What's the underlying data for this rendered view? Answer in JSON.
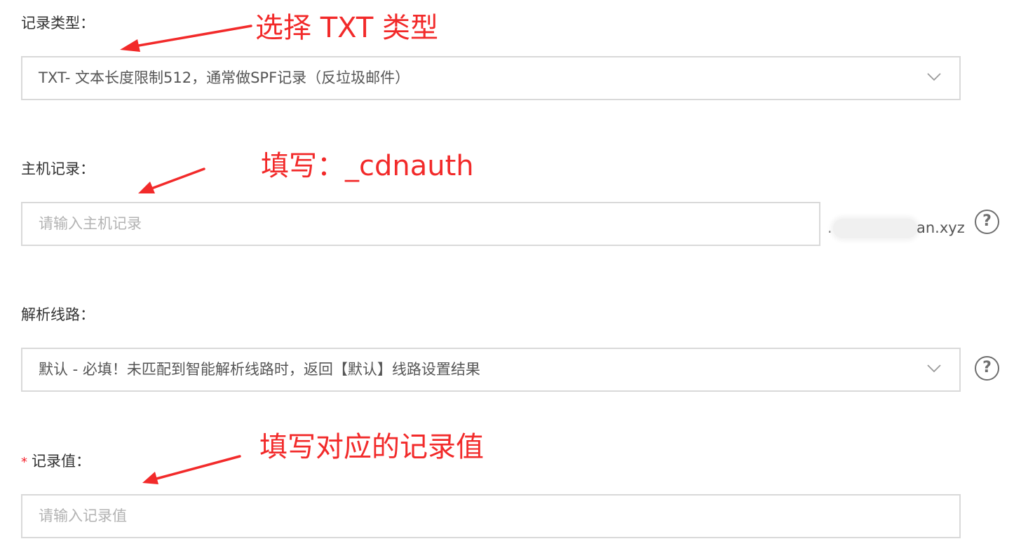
{
  "record_type": {
    "label": "记录类型：",
    "selected_value": "TXT- 文本长度限制512，通常做SPF记录（反垃圾邮件）"
  },
  "host_record": {
    "label": "主机记录：",
    "placeholder": "请输入主机记录",
    "domain_suffix_prefix": ".",
    "domain_suffix_tail": "an.xyz"
  },
  "line": {
    "label": "解析线路：",
    "selected_value": "默认 - 必填！未匹配到智能解析线路时，返回【默认】线路设置结果"
  },
  "record_value": {
    "required_mark": "*",
    "label": "记录值：",
    "placeholder": "请输入记录值"
  },
  "help_icon_glyph": "?",
  "annotations": {
    "type_note": "选择 TXT 类型",
    "host_note": "填写：_cdnauth",
    "value_note": "填写对应的记录值"
  },
  "colors": {
    "annotation": "#f22a2a",
    "border": "#d9d9d9",
    "placeholder": "#b3b3b3",
    "required": "#f5222d"
  },
  "icons": {
    "select_arrow": "chevron-down-icon",
    "help": "question-circle-icon",
    "annotation_arrow": "red-arrow-icon"
  }
}
